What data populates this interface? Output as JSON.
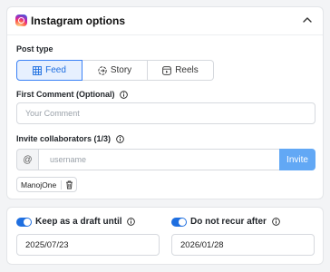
{
  "instagram": {
    "title": "Instagram options",
    "post_type": {
      "label": "Post type",
      "options": [
        {
          "label": "Feed",
          "icon": "grid-icon",
          "selected": true
        },
        {
          "label": "Story",
          "icon": "story-icon",
          "selected": false
        },
        {
          "label": "Reels",
          "icon": "reels-icon",
          "selected": false
        }
      ]
    },
    "first_comment": {
      "label": "First Comment (Optional)",
      "placeholder": "Your Comment",
      "value": ""
    },
    "collaborators": {
      "label": "Invite collaborators (1/3)",
      "prefix": "@",
      "placeholder": "username",
      "invite_label": "Invite",
      "chips": [
        "ManojOne"
      ]
    }
  },
  "schedule": {
    "draft": {
      "label": "Keep as a draft until",
      "enabled": true,
      "date": "2025/07/23"
    },
    "recur": {
      "label": "Do not recur after",
      "enabled": true,
      "date": "2026/01/28"
    }
  },
  "colors": {
    "accent": "#1f6fe0",
    "accent_light": "#e7f0fe",
    "invite_button": "#62a8f5",
    "border": "#d6d9de"
  }
}
